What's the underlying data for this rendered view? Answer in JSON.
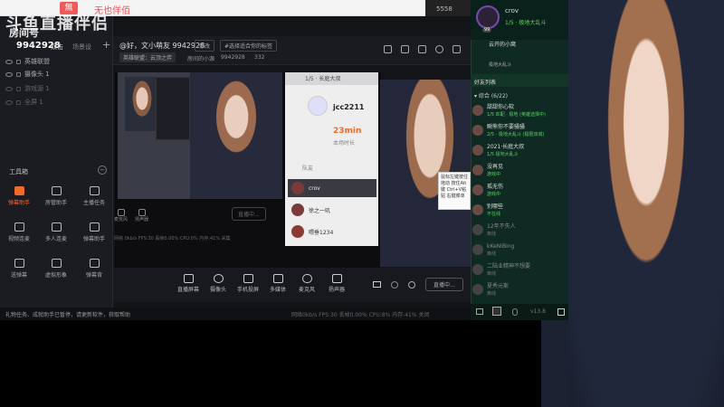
{
  "top": {
    "red_icon": "無",
    "title": "无也佯佰",
    "count": "5558"
  },
  "watermark": {
    "logo": "斗鱼直播伴侣",
    "sub": "房间号"
  },
  "scene_panel": {
    "room_id": "9942928",
    "tab_dual": "双击",
    "tab_scene": "场景设",
    "sources": [
      "英雄联盟",
      "摄像头 1",
      "游戏源 1",
      "全屏 1"
    ]
  },
  "tools": {
    "title": "工具箱",
    "items": [
      {
        "label": "弹幕助手",
        "active": true
      },
      {
        "label": "房管助手",
        "active": false
      },
      {
        "label": "主播任务",
        "active": false
      },
      {
        "label": "视频连麦",
        "active": false
      },
      {
        "label": "多人连麦",
        "active": false
      },
      {
        "label": "弹幕助手",
        "active": false
      },
      {
        "label": "送弹幕",
        "active": false
      },
      {
        "label": "虚拟形象",
        "active": false
      },
      {
        "label": "弹幕背",
        "active": false
      }
    ]
  },
  "stream_header": {
    "greeting": "@好，文小萌友 9942928",
    "modify": "修改",
    "tag": "#选择适合你的标签",
    "tag2": "英雄联盟：云顶之弈",
    "mini_link": "房间的小源",
    "mini_id": "9942928",
    "mini_fans": "332"
  },
  "card": {
    "title": "1/5 · 长庭大叔",
    "user": "jcc2211",
    "minutes": "23min",
    "min_label": "本场时长",
    "queue_label": "队友",
    "rows": [
      {
        "name": "crov",
        "selected": true
      },
      {
        "name": "徐之一叽",
        "selected": false
      },
      {
        "name": "喂垂1234",
        "selected": false
      }
    ]
  },
  "tooltip": "鼠标左键按住拖动 按住Alt键 Ctrl+V粘贴 右键菜单",
  "inner_controls": [
    "麦克风",
    "扬声器"
  ],
  "inner_live": "直播中...",
  "inner_status": "网络 0kb/s   FPS:30   丢帧0.00%   CPU:0%   内存:41%   采集",
  "toolbar": [
    {
      "label": "直播屏幕"
    },
    {
      "label": "摄像头"
    },
    {
      "label": "手机投屏"
    },
    {
      "label": "多媒体"
    },
    {
      "label": "麦克风"
    },
    {
      "label": "扬声器"
    }
  ],
  "live_btn": "直播中...",
  "status": {
    "notice": "礼物任务、成就助手已暂停，请更新软件，获取帮助",
    "stats": "网络0kb/s   FPS:30   丢帧0.00%   CPU:8%   内存:41%   关闭"
  },
  "right_app": {
    "user": "crov",
    "rank": "1/5 · 极地大乱斗",
    "level": "99",
    "group_title": "云开的小窝",
    "hub": "极地大乱斗",
    "friends_title": "好友列表",
    "group": "▾ 综合 (6/22)",
    "friends": [
      {
        "name": "甜甜你心软",
        "status": "1/5 匹配 · 极地 (英雄选择中)",
        "online": true
      },
      {
        "name": "瞬熊你不要骚骚",
        "status": "2/5 · 极地大乱斗 (极限双城)",
        "online": true
      },
      {
        "name": "2021·长庭大叔",
        "status": "1/5 极地大乱斗",
        "online": true
      },
      {
        "name": "没再见",
        "status": "游戏中",
        "online": true
      },
      {
        "name": "孤无伤",
        "status": "游戏中",
        "online": true
      },
      {
        "name": "别哪些",
        "status": "不在线",
        "online": true
      },
      {
        "name": "12年不失人",
        "status": "离线",
        "online": false
      },
      {
        "name": "kKeNiBing",
        "status": "离线",
        "online": false
      },
      {
        "name": "二陆业精神不想要",
        "status": "离线",
        "online": false
      },
      {
        "name": "夏秀元斯",
        "status": "离线",
        "online": false
      }
    ],
    "version": "v13.8"
  }
}
